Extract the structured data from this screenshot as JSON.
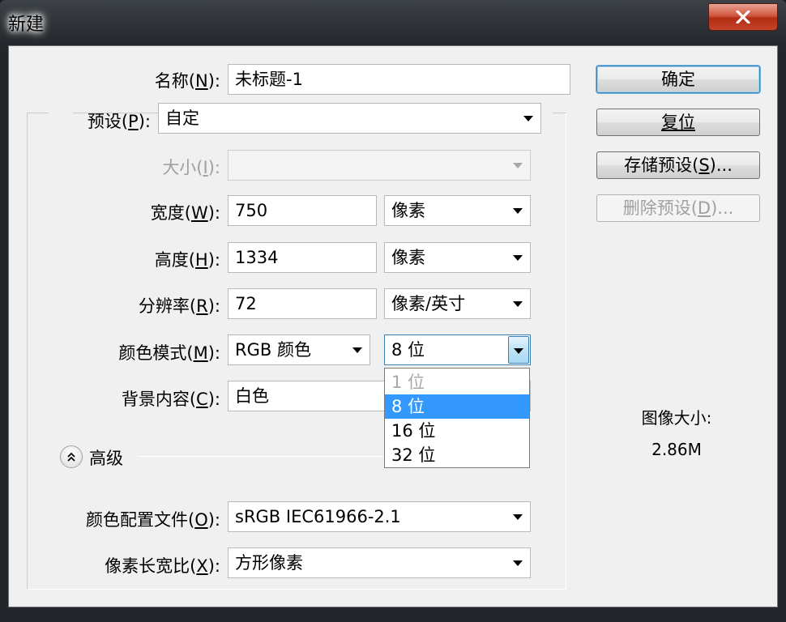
{
  "window": {
    "title": "新建"
  },
  "name": {
    "label_pre": "名称(",
    "label_key": "N",
    "label_post": "):",
    "value": "未标题-1"
  },
  "preset": {
    "label_pre": "预设(",
    "label_key": "P",
    "label_post": "):",
    "value": "自定"
  },
  "size": {
    "label_pre": "大小(",
    "label_key": "I",
    "label_post": "):",
    "value": ""
  },
  "width": {
    "label_pre": "宽度(",
    "label_key": "W",
    "label_post": "):",
    "value": "750",
    "unit": "像素"
  },
  "height": {
    "label_pre": "高度(",
    "label_key": "H",
    "label_post": "):",
    "value": "1334",
    "unit": "像素"
  },
  "resolution": {
    "label_pre": "分辨率(",
    "label_key": "R",
    "label_post": "):",
    "value": "72",
    "unit": "像素/英寸"
  },
  "color_mode": {
    "label_pre": "颜色模式(",
    "label_key": "M",
    "label_post": "):",
    "mode": "RGB 颜色",
    "depth": "8 位",
    "depth_options": [
      {
        "label": "1 位",
        "enabled": false,
        "selected": false
      },
      {
        "label": "8 位",
        "enabled": true,
        "selected": true
      },
      {
        "label": "16 位",
        "enabled": true,
        "selected": false
      },
      {
        "label": "32 位",
        "enabled": true,
        "selected": false
      }
    ]
  },
  "background": {
    "label_pre": "背景内容(",
    "label_key": "C",
    "label_post": "):",
    "value": "白色"
  },
  "advanced": {
    "label": "高级",
    "expanded": true
  },
  "color_profile": {
    "label_pre": "颜色配置文件(",
    "label_key": "O",
    "label_post": "):",
    "value": "sRGB IEC61966-2.1"
  },
  "pixel_aspect": {
    "label_pre": "像素长宽比(",
    "label_key": "X",
    "label_post": "):",
    "value": "方形像素"
  },
  "buttons": {
    "ok": "确定",
    "reset": "复位",
    "save_pre": "存储预设(",
    "save_key": "S",
    "save_post": ")...",
    "delete_pre": "删除预设(",
    "delete_key": "D",
    "delete_post": ")..."
  },
  "image_size": {
    "title": "图像大小:",
    "value": "2.86M"
  },
  "colors": {
    "accent": "#3399ff",
    "close": "#c4442a"
  }
}
